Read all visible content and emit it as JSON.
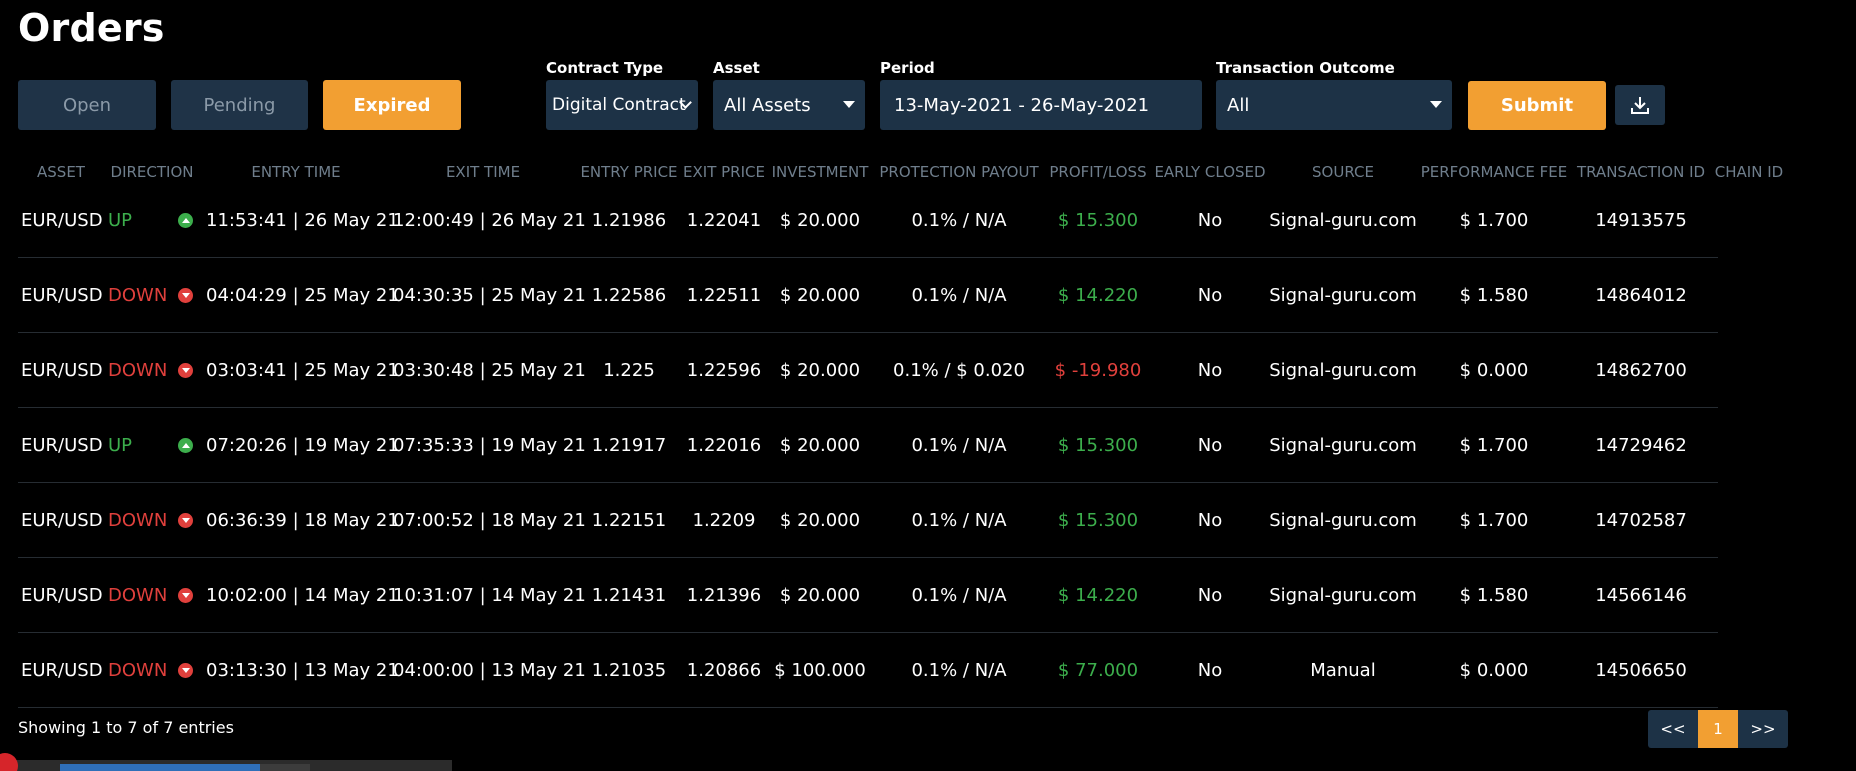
{
  "page": {
    "title": "Orders"
  },
  "tabs": [
    {
      "label": "Open"
    },
    {
      "label": "Pending"
    },
    {
      "label": "Expired"
    }
  ],
  "filters": {
    "contract_type": {
      "label": "Contract Type",
      "value": "Digital Contract"
    },
    "asset": {
      "label": "Asset",
      "value": "All Assets"
    },
    "period": {
      "label": "Period",
      "value": "13-May-2021 - 26-May-2021"
    },
    "outcome": {
      "label": "Transaction Outcome",
      "value": "All"
    },
    "submit_label": "Submit"
  },
  "table": {
    "headers": [
      "ASSET",
      "DIRECTION",
      "ENTRY TIME",
      "EXIT TIME",
      "ENTRY PRICE",
      "EXIT PRICE",
      "INVESTMENT",
      "PROTECTION PAYOUT",
      "PROFIT/LOSS",
      "EARLY CLOSED",
      "SOURCE",
      "PERFORMANCE FEE",
      "TRANSACTION ID",
      "CHAIN ID"
    ],
    "rows": [
      {
        "asset": "EUR/USD",
        "direction": "UP",
        "entry_time": "11:53:41 | 26 May 21",
        "exit_time": "12:00:49 | 26 May 21",
        "entry_price": "1.21986",
        "exit_price": "1.22041",
        "investment": "$ 20.000",
        "protection": "0.1% / N/A",
        "pl": "$ 15.300",
        "early_closed": "No",
        "source": "Signal-guru.com",
        "fee": "$ 1.700",
        "tx_id": "14913575",
        "chain_id": ""
      },
      {
        "asset": "EUR/USD",
        "direction": "DOWN",
        "entry_time": "04:04:29 | 25 May 21",
        "exit_time": "04:30:35 | 25 May 21",
        "entry_price": "1.22586",
        "exit_price": "1.22511",
        "investment": "$ 20.000",
        "protection": "0.1% / N/A",
        "pl": "$ 14.220",
        "early_closed": "No",
        "source": "Signal-guru.com",
        "fee": "$ 1.580",
        "tx_id": "14864012",
        "chain_id": ""
      },
      {
        "asset": "EUR/USD",
        "direction": "DOWN",
        "entry_time": "03:03:41 | 25 May 21",
        "exit_time": "03:30:48 | 25 May 21",
        "entry_price": "1.225",
        "exit_price": "1.22596",
        "investment": "$ 20.000",
        "protection": "0.1% / $ 0.020",
        "pl": "$ -19.980",
        "early_closed": "No",
        "source": "Signal-guru.com",
        "fee": "$ 0.000",
        "tx_id": "14862700",
        "chain_id": ""
      },
      {
        "asset": "EUR/USD",
        "direction": "UP",
        "entry_time": "07:20:26 | 19 May 21",
        "exit_time": "07:35:33 | 19 May 21",
        "entry_price": "1.21917",
        "exit_price": "1.22016",
        "investment": "$ 20.000",
        "protection": "0.1% / N/A",
        "pl": "$ 15.300",
        "early_closed": "No",
        "source": "Signal-guru.com",
        "fee": "$ 1.700",
        "tx_id": "14729462",
        "chain_id": ""
      },
      {
        "asset": "EUR/USD",
        "direction": "DOWN",
        "entry_time": "06:36:39 | 18 May 21",
        "exit_time": "07:00:52 | 18 May 21",
        "entry_price": "1.22151",
        "exit_price": "1.2209",
        "investment": "$ 20.000",
        "protection": "0.1% / N/A",
        "pl": "$ 15.300",
        "early_closed": "No",
        "source": "Signal-guru.com",
        "fee": "$ 1.700",
        "tx_id": "14702587",
        "chain_id": ""
      },
      {
        "asset": "EUR/USD",
        "direction": "DOWN",
        "entry_time": "10:02:00 | 14 May 21",
        "exit_time": "10:31:07 | 14 May 21",
        "entry_price": "1.21431",
        "exit_price": "1.21396",
        "investment": "$ 20.000",
        "protection": "0.1% / N/A",
        "pl": "$ 14.220",
        "early_closed": "No",
        "source": "Signal-guru.com",
        "fee": "$ 1.580",
        "tx_id": "14566146",
        "chain_id": ""
      },
      {
        "asset": "EUR/USD",
        "direction": "DOWN",
        "entry_time": "03:13:30 | 13 May 21",
        "exit_time": "04:00:00 | 13 May 21",
        "entry_price": "1.21035",
        "exit_price": "1.20866",
        "investment": "$ 100.000",
        "protection": "0.1% / N/A",
        "pl": "$ 77.000",
        "early_closed": "No",
        "source": "Manual",
        "fee": "$ 0.000",
        "tx_id": "14506650",
        "chain_id": ""
      }
    ]
  },
  "footer": {
    "showing": "Showing 1 to 7 of 7 entries"
  },
  "pagination": {
    "prev": "<<",
    "current": "1",
    "next": ">>"
  },
  "colors": {
    "accent": "#f29f32",
    "panel": "#1d3246",
    "positive": "#3cae4c",
    "negative": "#e0403c"
  },
  "icons": {
    "up": "up-arrow-circle-icon",
    "down": "down-arrow-circle-icon",
    "download": "download-icon",
    "dropdown": "dropdown-caret-icon"
  }
}
